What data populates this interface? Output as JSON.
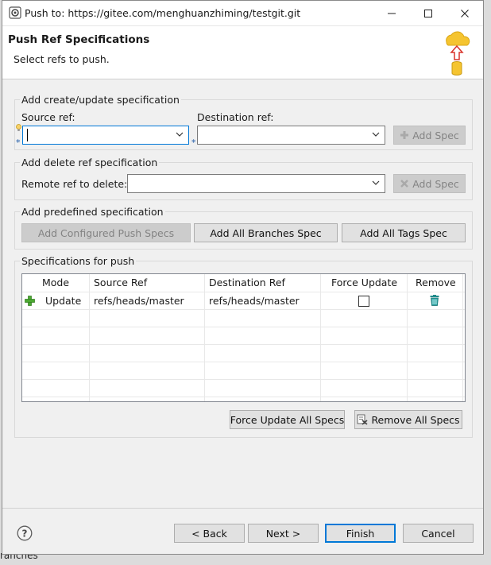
{
  "window": {
    "title": "Push to: https://gitee.com/menghuanzhiming/testgit.git",
    "controls": [
      "minimize-icon",
      "maximize-icon",
      "close-icon"
    ]
  },
  "header": {
    "title": "Push Ref Specifications",
    "description": "Select refs to push."
  },
  "create_update": {
    "group_title": "Add create/update specification",
    "source_label": "Source ref:",
    "source_value": "",
    "destination_label": "Destination ref:",
    "destination_value": "",
    "add_spec_label": "Add Spec"
  },
  "delete_ref": {
    "group_title": "Add delete ref specification",
    "remote_label": "Remote ref to delete:",
    "remote_value": "",
    "add_spec_label": "Add Spec"
  },
  "predefined": {
    "group_title": "Add predefined specification",
    "configured_label": "Add Configured Push Specs",
    "all_branches_label": "Add All Branches Spec",
    "all_tags_label": "Add All Tags Spec"
  },
  "specs": {
    "group_title": "Specifications for push",
    "columns": [
      "Mode",
      "Source Ref",
      "Destination Ref",
      "Force Update",
      "Remove"
    ],
    "rows": [
      {
        "mode": "Update",
        "source": "refs/heads/master",
        "destination": "refs/heads/master",
        "force_update": false
      }
    ],
    "force_all_label": "Force Update All Specs",
    "remove_all_label": "Remove All Specs"
  },
  "footer": {
    "back_label": "< Back",
    "next_label": "Next >",
    "finish_label": "Finish",
    "cancel_label": "Cancel"
  },
  "background": {
    "bottom_text": "ranches"
  },
  "colors": {
    "accent": "#0078d7",
    "add_icon": "#3a9a2b",
    "trash_icon": "#1f8a8a",
    "cloud": "#f5c430"
  }
}
